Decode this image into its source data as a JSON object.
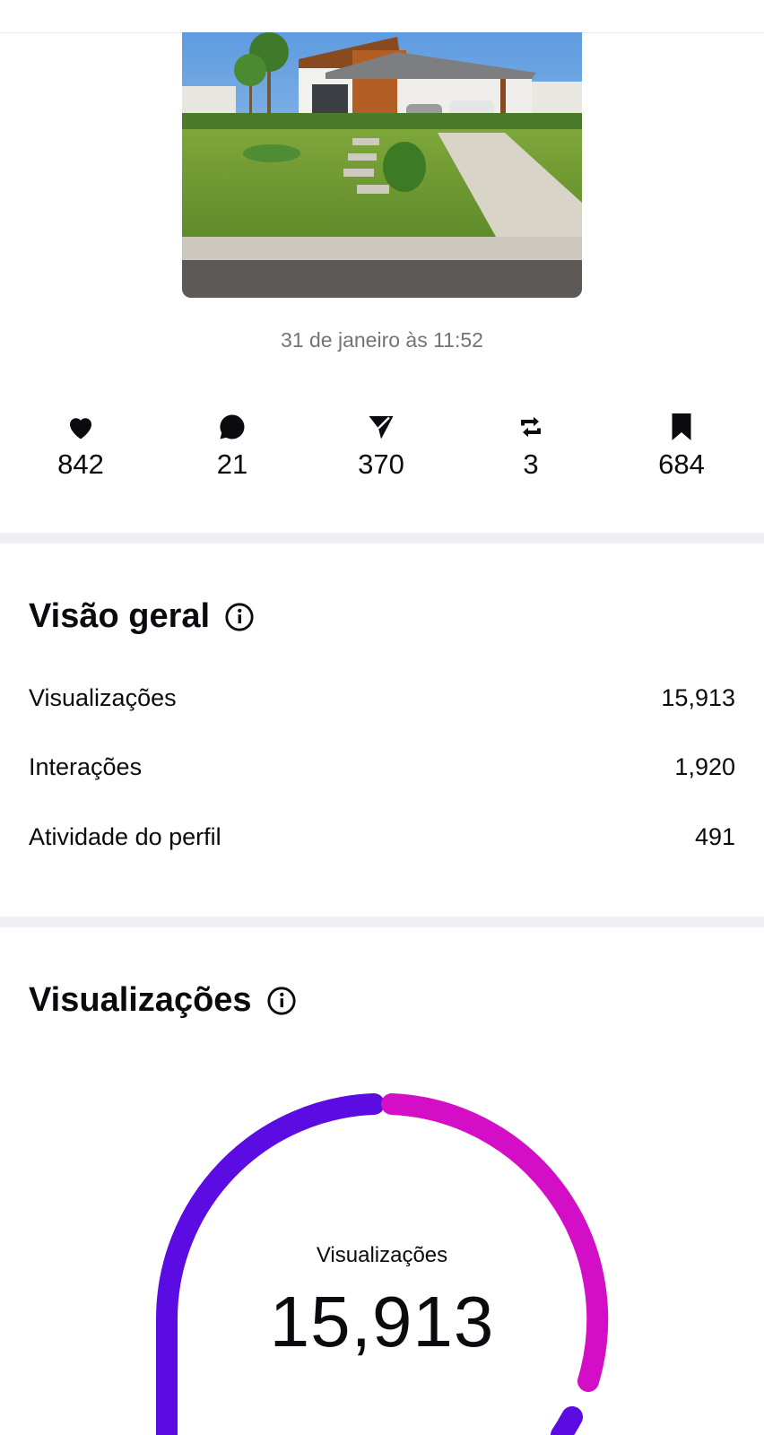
{
  "post": {
    "timestamp": "31 de janeiro às 11:52"
  },
  "stats": [
    {
      "icon": "heart-icon",
      "value": "842"
    },
    {
      "icon": "comment-icon",
      "value": "21"
    },
    {
      "icon": "share-icon",
      "value": "370"
    },
    {
      "icon": "repost-icon",
      "value": "3"
    },
    {
      "icon": "bookmark-icon",
      "value": "684"
    }
  ],
  "overview": {
    "title": "Visão geral",
    "rows": [
      {
        "label": "Visualizações",
        "value": "15,913"
      },
      {
        "label": "Interações",
        "value": "1,920"
      },
      {
        "label": "Atividade do perfil",
        "value": "491"
      }
    ]
  },
  "views": {
    "title": "Visualizações",
    "donut_label": "Visualizações",
    "donut_value": "15,913",
    "colors": {
      "primary": "#5a0ce3",
      "secondary": "#d40dc6"
    }
  },
  "colors": {
    "divider": "#eff0f3",
    "muted_text": "#737378"
  }
}
